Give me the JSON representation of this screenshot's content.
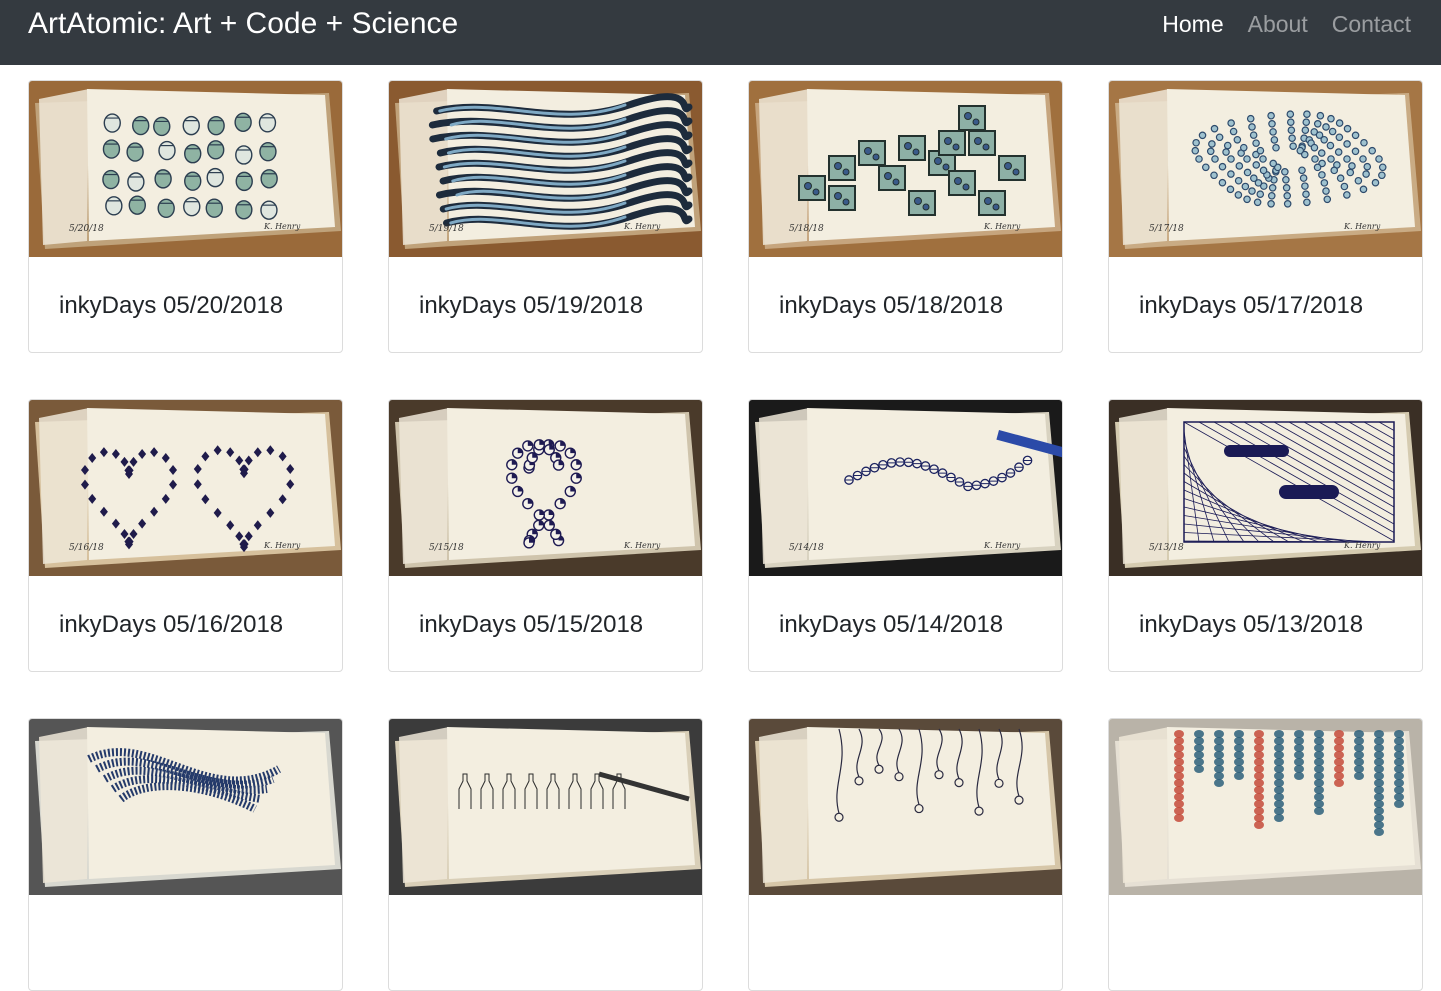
{
  "navbar": {
    "brand": "ArtAtomic: Art + Code + Science",
    "links": [
      {
        "label": "Home",
        "active": true
      },
      {
        "label": "About",
        "active": false
      },
      {
        "label": "Contact",
        "active": false
      }
    ]
  },
  "cards": [
    {
      "title": "inkyDays 05/20/2018",
      "pattern": "acorns",
      "table": "#9a6a3a",
      "edge": "#bfa27a",
      "ink": "#2c3e50",
      "accent": "#8fb3a3",
      "date_mark": "5/20/18"
    },
    {
      "title": "inkyDays 05/19/2018",
      "pattern": "waves",
      "table": "#8a5a30",
      "edge": "#c0a27a",
      "ink": "#1d2b3c",
      "accent": "#7fa9c4",
      "date_mark": "5/19/18"
    },
    {
      "title": "inkyDays 05/18/2018",
      "pattern": "boxes",
      "table": "#a0703e",
      "edge": "#c6a57e",
      "ink": "#23312e",
      "accent": "#8db0a6",
      "date_mark": "5/18/18"
    },
    {
      "title": "inkyDays 05/17/2018",
      "pattern": "dots",
      "table": "#a57645",
      "edge": "#c9ab84",
      "ink": "#2d4a6b",
      "accent": "#9fc2cf",
      "date_mark": "5/17/18"
    },
    {
      "title": "inkyDays 05/16/2018",
      "pattern": "hearts",
      "table": "#7a5a3a",
      "edge": "#d6c09c",
      "ink": "#1f1b4b",
      "accent": "#e8e0c8",
      "date_mark": "5/16/18"
    },
    {
      "title": "inkyDays 05/15/2018",
      "pattern": "heartdots",
      "table": "#4a3a2a",
      "edge": "#cfc4ac",
      "ink": "#1e1a52",
      "accent": "#b9c8d6",
      "date_mark": "5/15/18"
    },
    {
      "title": "inkyDays 05/14/2018",
      "pattern": "spiral",
      "table": "#1a1a1a",
      "edge": "#d8d2c0",
      "ink": "#1c2360",
      "accent": "#e6e1d2",
      "date_mark": "5/14/18"
    },
    {
      "title": "inkyDays 05/13/2018",
      "pattern": "lines",
      "table": "#3a2f25",
      "edge": "#d5cbb0",
      "ink": "#1a1a55",
      "accent": "#ece6d2",
      "date_mark": "5/13/18"
    },
    {
      "title": "",
      "pattern": "maze",
      "table": "#555555",
      "edge": "#d8d8d0",
      "ink": "#243a6a",
      "accent": "#e4e4dc",
      "date_mark": ""
    },
    {
      "title": "",
      "pattern": "bottles",
      "table": "#3b3b3b",
      "edge": "#d9cfb8",
      "ink": "#2a2a2a",
      "accent": "#e6dec8",
      "date_mark": ""
    },
    {
      "title": "",
      "pattern": "flowers",
      "table": "#5a4a3a",
      "edge": "#d6c6a8",
      "ink": "#2a2a40",
      "accent": "#e3d6bc",
      "date_mark": ""
    },
    {
      "title": "",
      "pattern": "drips",
      "table": "#b9b3a8",
      "edge": "#e6e0d4",
      "ink": "#2c5f7a",
      "accent": "#c44a3a",
      "date_mark": ""
    }
  ]
}
